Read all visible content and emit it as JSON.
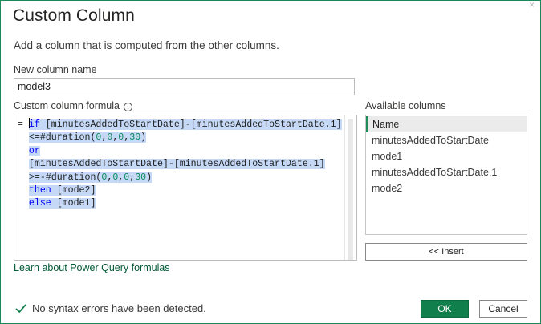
{
  "dialog": {
    "title": "Custom Column",
    "subtitle": "Add a column that is computed from the other columns."
  },
  "new_column": {
    "label": "New column name",
    "value": "model3"
  },
  "formula": {
    "label": "Custom column formula",
    "info_icon": "info-icon",
    "lines": [
      {
        "prefix": "= ",
        "tokens": [
          {
            "t": "if",
            "c": "kw"
          },
          {
            "t": " [minutesAddedToStartDate]-[minutesAddedToStartDate.1]",
            "c": ""
          }
        ]
      },
      {
        "prefix": "  ",
        "tokens": [
          {
            "t": "<=#duration(",
            "c": ""
          },
          {
            "t": "0",
            "c": "num"
          },
          {
            "t": ",",
            "c": ""
          },
          {
            "t": "0",
            "c": "num"
          },
          {
            "t": ",",
            "c": ""
          },
          {
            "t": "0",
            "c": "num"
          },
          {
            "t": ",",
            "c": ""
          },
          {
            "t": "30",
            "c": "num"
          },
          {
            "t": ")",
            "c": ""
          }
        ]
      },
      {
        "prefix": "  ",
        "tokens": [
          {
            "t": "or",
            "c": "kw"
          }
        ]
      },
      {
        "prefix": "  ",
        "tokens": [
          {
            "t": "[minutesAddedToStartDate]-[minutesAddedToStartDate.1]",
            "c": ""
          }
        ]
      },
      {
        "prefix": "  ",
        "tokens": [
          {
            "t": ">=-#duration(",
            "c": ""
          },
          {
            "t": "0",
            "c": "num"
          },
          {
            "t": ",",
            "c": ""
          },
          {
            "t": "0",
            "c": "num"
          },
          {
            "t": ",",
            "c": ""
          },
          {
            "t": "0",
            "c": "num"
          },
          {
            "t": ",",
            "c": ""
          },
          {
            "t": "30",
            "c": "num"
          },
          {
            "t": ")",
            "c": ""
          }
        ]
      },
      {
        "prefix": "  ",
        "tokens": [
          {
            "t": "then",
            "c": "kw"
          },
          {
            "t": " [mode2]",
            "c": ""
          }
        ]
      },
      {
        "prefix": "  ",
        "tokens": [
          {
            "t": "else",
            "c": "kw"
          },
          {
            "t": " [mode1]",
            "c": ""
          }
        ]
      }
    ]
  },
  "learn_link": "Learn about Power Query formulas",
  "available": {
    "label": "Available columns",
    "items": [
      "Name",
      "minutesAddedToStartDate",
      "mode1",
      "minutesAddedToStartDate.1",
      "mode2"
    ],
    "insert_label": "<< Insert"
  },
  "status": {
    "icon": "check-icon",
    "text": "No syntax errors have been detected."
  },
  "buttons": {
    "ok": "OK",
    "cancel": "Cancel"
  },
  "colors": {
    "accent": "#117f4c",
    "keyword": "#0000ff",
    "number": "#09885a",
    "selection": "#c5d9f7",
    "link": "#005a36"
  }
}
